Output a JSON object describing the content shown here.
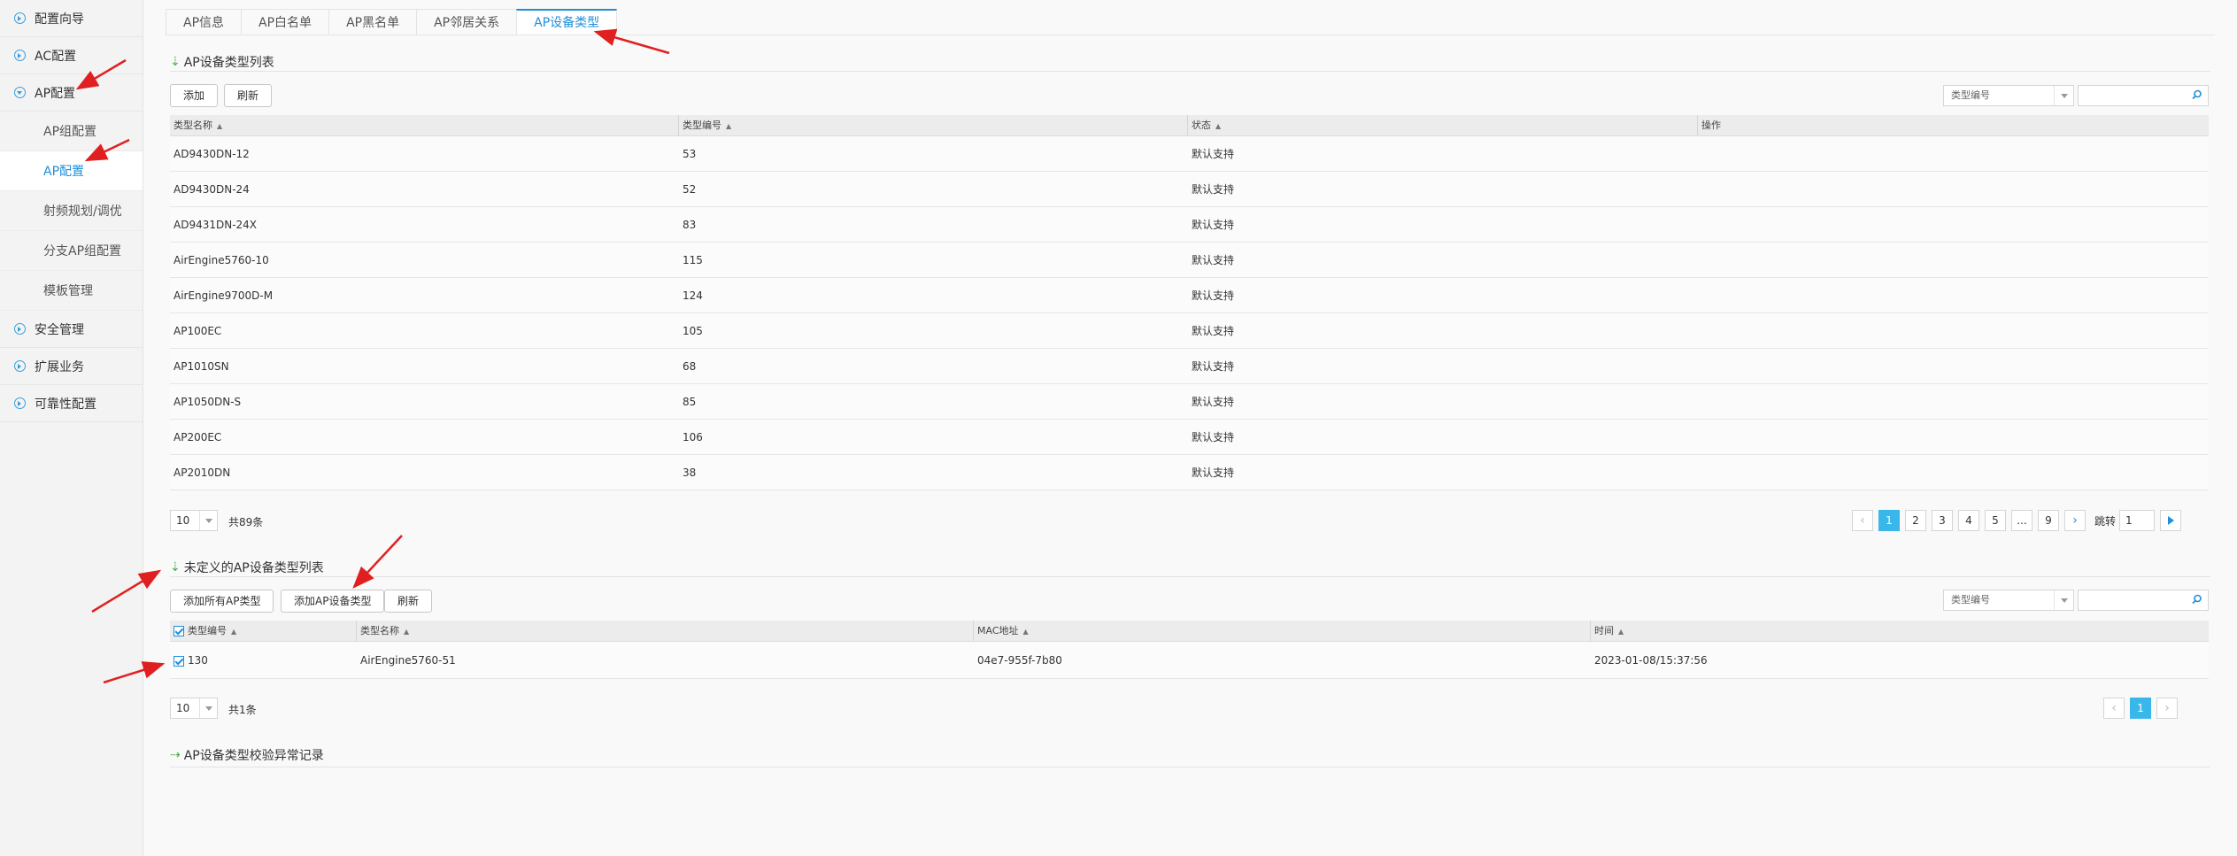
{
  "sidebar": {
    "items": [
      {
        "label": "配置向导"
      },
      {
        "label": "AC配置"
      },
      {
        "label": "AP配置"
      },
      {
        "label": "安全管理"
      },
      {
        "label": "扩展业务"
      },
      {
        "label": "可靠性配置"
      }
    ],
    "ap_sub_items": [
      {
        "label": "AP组配置"
      },
      {
        "label": "AP配置"
      },
      {
        "label": "射频规划/调优"
      },
      {
        "label": "分支AP组配置"
      },
      {
        "label": "模板管理"
      }
    ]
  },
  "tabs": [
    {
      "label": "AP信息"
    },
    {
      "label": "AP白名单"
    },
    {
      "label": "AP黑名单"
    },
    {
      "label": "AP邻居关系"
    },
    {
      "label": "AP设备类型"
    }
  ],
  "type_list": {
    "title": "AP设备类型列表",
    "add_label": "添加",
    "refresh_label": "刷新",
    "search_field": "类型编号",
    "columns": [
      "类型名称",
      "类型编号",
      "状态",
      "操作"
    ],
    "rows": [
      {
        "name": "AD9430DN-12",
        "id": "53",
        "status": "默认支持"
      },
      {
        "name": "AD9430DN-24",
        "id": "52",
        "status": "默认支持"
      },
      {
        "name": "AD9431DN-24X",
        "id": "83",
        "status": "默认支持"
      },
      {
        "name": "AirEngine5760-10",
        "id": "115",
        "status": "默认支持"
      },
      {
        "name": "AirEngine9700D-M",
        "id": "124",
        "status": "默认支持"
      },
      {
        "name": "AP100EC",
        "id": "105",
        "status": "默认支持"
      },
      {
        "name": "AP1010SN",
        "id": "68",
        "status": "默认支持"
      },
      {
        "name": "AP1050DN-S",
        "id": "85",
        "status": "默认支持"
      },
      {
        "name": "AP200EC",
        "id": "106",
        "status": "默认支持"
      },
      {
        "name": "AP2010DN",
        "id": "38",
        "status": "默认支持"
      }
    ],
    "page_size": "10",
    "total": "共89条",
    "pages": [
      "1",
      "2",
      "3",
      "4",
      "5",
      "...",
      "9"
    ],
    "current_page": "1",
    "jump_label": "跳转",
    "jump_value": "1"
  },
  "undefined_list": {
    "title": "未定义的AP设备类型列表",
    "add_all_label": "添加所有AP类型",
    "add_type_label": "添加AP设备类型",
    "refresh_label": "刷新",
    "search_field": "类型编号",
    "columns": [
      "类型编号",
      "类型名称",
      "MAC地址",
      "时间"
    ],
    "rows": [
      {
        "id": "130",
        "name": "AirEngine5760-51",
        "mac": "04e7-955f-7b80",
        "time": "2023-01-08/15:37:56",
        "checked": true
      }
    ],
    "page_size": "10",
    "total": "共1条",
    "current_page": "1"
  },
  "exception_log": {
    "title": "AP设备类型校验异常记录"
  },
  "colors": {
    "accent": "#1f8fd9",
    "page_active": "#39b6ea",
    "annotation_arrow": "#e02020",
    "section_arrow": "#49b24a"
  }
}
